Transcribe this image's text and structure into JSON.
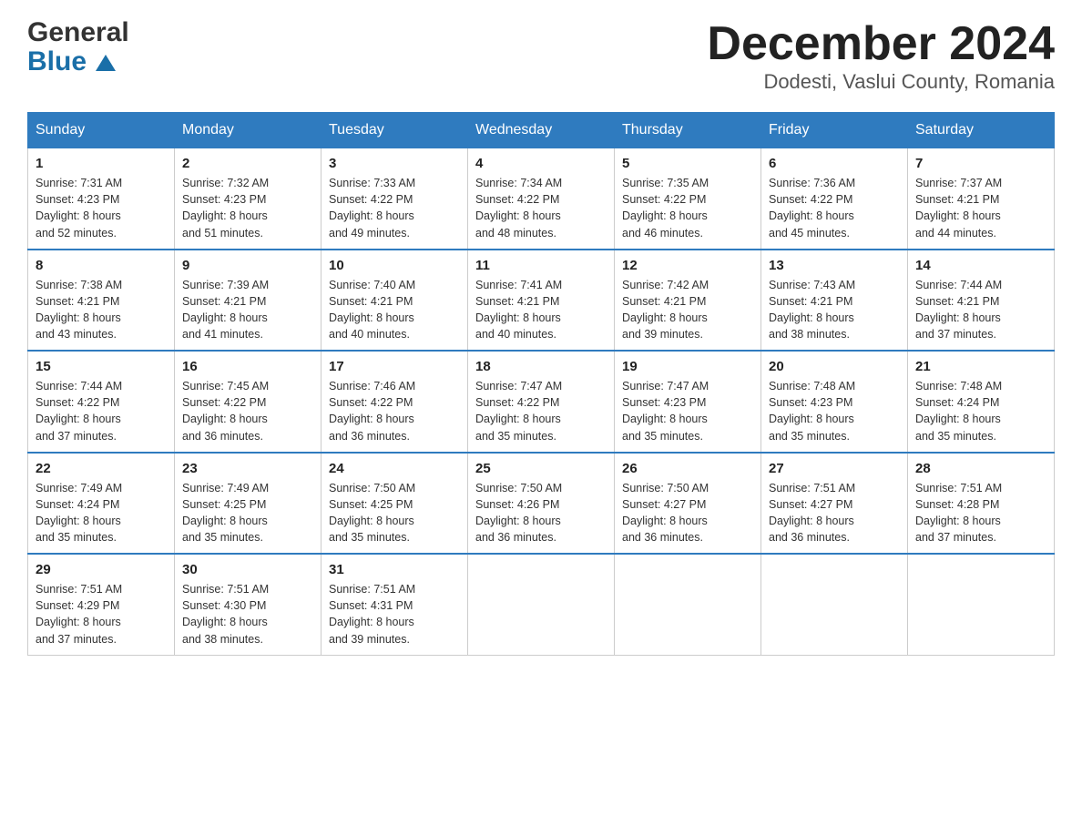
{
  "header": {
    "logo_general": "General",
    "logo_blue": "Blue",
    "title": "December 2024",
    "subtitle": "Dodesti, Vaslui County, Romania"
  },
  "days_of_week": [
    "Sunday",
    "Monday",
    "Tuesday",
    "Wednesday",
    "Thursday",
    "Friday",
    "Saturday"
  ],
  "weeks": [
    [
      {
        "day": "1",
        "sunrise": "7:31 AM",
        "sunset": "4:23 PM",
        "daylight": "8 hours and 52 minutes."
      },
      {
        "day": "2",
        "sunrise": "7:32 AM",
        "sunset": "4:23 PM",
        "daylight": "8 hours and 51 minutes."
      },
      {
        "day": "3",
        "sunrise": "7:33 AM",
        "sunset": "4:22 PM",
        "daylight": "8 hours and 49 minutes."
      },
      {
        "day": "4",
        "sunrise": "7:34 AM",
        "sunset": "4:22 PM",
        "daylight": "8 hours and 48 minutes."
      },
      {
        "day": "5",
        "sunrise": "7:35 AM",
        "sunset": "4:22 PM",
        "daylight": "8 hours and 46 minutes."
      },
      {
        "day": "6",
        "sunrise": "7:36 AM",
        "sunset": "4:22 PM",
        "daylight": "8 hours and 45 minutes."
      },
      {
        "day": "7",
        "sunrise": "7:37 AM",
        "sunset": "4:21 PM",
        "daylight": "8 hours and 44 minutes."
      }
    ],
    [
      {
        "day": "8",
        "sunrise": "7:38 AM",
        "sunset": "4:21 PM",
        "daylight": "8 hours and 43 minutes."
      },
      {
        "day": "9",
        "sunrise": "7:39 AM",
        "sunset": "4:21 PM",
        "daylight": "8 hours and 41 minutes."
      },
      {
        "day": "10",
        "sunrise": "7:40 AM",
        "sunset": "4:21 PM",
        "daylight": "8 hours and 40 minutes."
      },
      {
        "day": "11",
        "sunrise": "7:41 AM",
        "sunset": "4:21 PM",
        "daylight": "8 hours and 40 minutes."
      },
      {
        "day": "12",
        "sunrise": "7:42 AM",
        "sunset": "4:21 PM",
        "daylight": "8 hours and 39 minutes."
      },
      {
        "day": "13",
        "sunrise": "7:43 AM",
        "sunset": "4:21 PM",
        "daylight": "8 hours and 38 minutes."
      },
      {
        "day": "14",
        "sunrise": "7:44 AM",
        "sunset": "4:21 PM",
        "daylight": "8 hours and 37 minutes."
      }
    ],
    [
      {
        "day": "15",
        "sunrise": "7:44 AM",
        "sunset": "4:22 PM",
        "daylight": "8 hours and 37 minutes."
      },
      {
        "day": "16",
        "sunrise": "7:45 AM",
        "sunset": "4:22 PM",
        "daylight": "8 hours and 36 minutes."
      },
      {
        "day": "17",
        "sunrise": "7:46 AM",
        "sunset": "4:22 PM",
        "daylight": "8 hours and 36 minutes."
      },
      {
        "day": "18",
        "sunrise": "7:47 AM",
        "sunset": "4:22 PM",
        "daylight": "8 hours and 35 minutes."
      },
      {
        "day": "19",
        "sunrise": "7:47 AM",
        "sunset": "4:23 PM",
        "daylight": "8 hours and 35 minutes."
      },
      {
        "day": "20",
        "sunrise": "7:48 AM",
        "sunset": "4:23 PM",
        "daylight": "8 hours and 35 minutes."
      },
      {
        "day": "21",
        "sunrise": "7:48 AM",
        "sunset": "4:24 PM",
        "daylight": "8 hours and 35 minutes."
      }
    ],
    [
      {
        "day": "22",
        "sunrise": "7:49 AM",
        "sunset": "4:24 PM",
        "daylight": "8 hours and 35 minutes."
      },
      {
        "day": "23",
        "sunrise": "7:49 AM",
        "sunset": "4:25 PM",
        "daylight": "8 hours and 35 minutes."
      },
      {
        "day": "24",
        "sunrise": "7:50 AM",
        "sunset": "4:25 PM",
        "daylight": "8 hours and 35 minutes."
      },
      {
        "day": "25",
        "sunrise": "7:50 AM",
        "sunset": "4:26 PM",
        "daylight": "8 hours and 36 minutes."
      },
      {
        "day": "26",
        "sunrise": "7:50 AM",
        "sunset": "4:27 PM",
        "daylight": "8 hours and 36 minutes."
      },
      {
        "day": "27",
        "sunrise": "7:51 AM",
        "sunset": "4:27 PM",
        "daylight": "8 hours and 36 minutes."
      },
      {
        "day": "28",
        "sunrise": "7:51 AM",
        "sunset": "4:28 PM",
        "daylight": "8 hours and 37 minutes."
      }
    ],
    [
      {
        "day": "29",
        "sunrise": "7:51 AM",
        "sunset": "4:29 PM",
        "daylight": "8 hours and 37 minutes."
      },
      {
        "day": "30",
        "sunrise": "7:51 AM",
        "sunset": "4:30 PM",
        "daylight": "8 hours and 38 minutes."
      },
      {
        "day": "31",
        "sunrise": "7:51 AM",
        "sunset": "4:31 PM",
        "daylight": "8 hours and 39 minutes."
      },
      null,
      null,
      null,
      null
    ]
  ],
  "labels": {
    "sunrise": "Sunrise:",
    "sunset": "Sunset:",
    "daylight": "Daylight:"
  },
  "colors": {
    "header_bg": "#2f7bbf",
    "header_text": "#ffffff",
    "border": "#2f7bbf",
    "accent_blue": "#1a6fa8"
  }
}
